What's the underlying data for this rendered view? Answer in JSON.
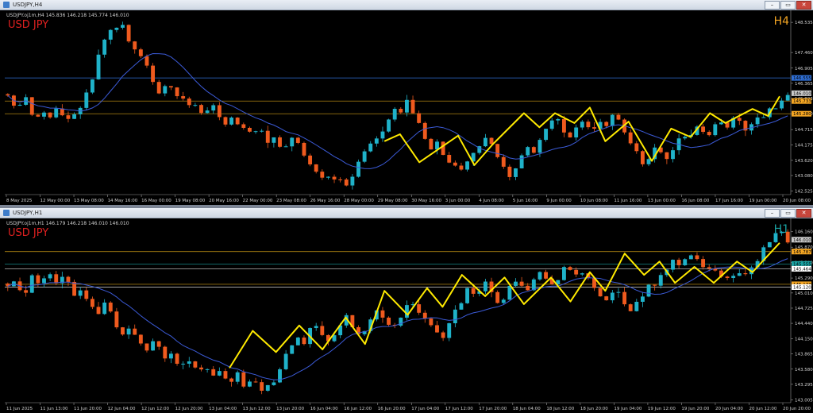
{
  "windows": [
    {
      "id": "h4",
      "title": "USDJPY,H4",
      "info": "USDJPY.oj1m,H4  145.836 146.218 145.774 146.010",
      "symbol_label": "USD JPY",
      "timeframe_label": "H4",
      "timeframe_color": "#f5a623",
      "buttons": {
        "minimize": "–",
        "restore": "▭",
        "close": "✕"
      },
      "chart_data": {
        "type": "candlestick",
        "ylim": [
          142.4,
          148.85
        ],
        "y_ticks": [
          148.535,
          147.46,
          146.905,
          146.365,
          145.823,
          145.28,
          144.715,
          144.175,
          143.62,
          143.08,
          142.525,
          141.985
        ],
        "price_tags": [
          {
            "value": 146.555,
            "color": "#2f6fd6",
            "text": "146.555"
          },
          {
            "value": 146.01,
            "color": "#c9c9c9",
            "text": "146.010"
          },
          {
            "value": 145.733,
            "color": "#f5a623",
            "text": "145.733"
          },
          {
            "value": 145.28,
            "color": "#f5a623",
            "text": "145.280"
          }
        ],
        "h_lines": [
          {
            "value": 146.555,
            "color": "#2f6fd6"
          },
          {
            "value": 145.733,
            "color": "#d4a017"
          },
          {
            "value": 145.28,
            "color": "#d4a017"
          }
        ],
        "x_labels": [
          "8 May 2025",
          "12 May 00:00",
          "13 May 08:00",
          "14 May 16:00",
          "16 May 00:00",
          "19 May 08:00",
          "20 May 16:00",
          "22 May 00:00",
          "23 May 08:00",
          "26 May 16:00",
          "28 May 00:00",
          "29 May 08:00",
          "30 May 16:00",
          "3 Jun 00:00",
          "4 Jun 08:00",
          "5 Jun 16:00",
          "9 Jun 00:00",
          "10 Jun 08:00",
          "11 Jun 16:00",
          "13 Jun 00:00",
          "16 Jun 08:00",
          "17 Jun 16:00",
          "19 Jun 00:00",
          "20 Jun 08:00"
        ],
        "anchors": [
          145.9,
          145.6,
          145.3,
          146.2,
          145.4,
          145.2,
          145.1,
          145.4,
          145.2,
          145.5,
          145.3,
          145.1,
          145.0,
          145.4,
          145.6,
          146.1,
          146.5,
          147.4,
          147.8,
          148.4,
          148.1,
          148.55,
          148.3,
          147.8,
          147.6,
          147.4,
          147.1,
          146.6,
          146.2,
          145.9,
          146.4,
          146.1,
          145.9,
          145.8,
          145.5,
          145.7,
          145.4,
          145.2,
          145.5,
          145.6,
          145.1,
          144.9,
          145.2,
          145.0,
          144.8,
          144.7,
          144.5,
          144.8,
          144.6,
          144.3,
          144.5,
          144.2,
          143.9,
          144.3,
          144.5,
          144.1,
          143.8,
          143.5,
          143.3,
          143.0,
          142.9,
          143.2,
          142.8,
          143.0,
          142.7,
          143.1,
          143.5,
          143.9,
          144.1,
          144.4,
          144.3,
          144.8,
          145.1,
          145.5,
          145.3,
          145.9,
          145.4,
          145.1,
          144.7,
          144.2,
          143.9,
          144.3,
          143.8,
          143.5,
          143.6,
          143.2,
          143.4,
          143.7,
          143.9,
          144.2,
          144.4,
          144.2,
          143.9,
          143.5,
          143.2,
          143.0,
          143.4,
          143.8,
          144.1,
          143.8,
          144.2,
          144.6,
          144.9,
          145.2,
          145.0,
          144.6,
          144.4,
          144.8,
          145.1,
          144.9,
          144.6,
          144.9,
          145.1,
          144.8,
          145.2,
          145.1,
          144.7,
          144.4,
          144.0,
          143.8,
          143.4,
          143.7,
          144.1,
          143.9,
          143.6,
          143.8,
          144.2,
          144.5,
          144.4,
          144.6,
          144.9,
          144.7,
          144.5,
          144.8,
          145.1,
          144.9,
          144.8,
          145.2,
          145.0,
          144.7,
          144.9,
          145.2,
          145.0,
          145.4,
          145.6,
          145.4,
          145.8,
          146.0
        ],
        "ma_color": "#3b5ad6",
        "zigzag_color": "#ffea00",
        "zigzag": [
          [
            0.49,
            144.3
          ],
          [
            0.51,
            144.55
          ],
          [
            0.535,
            143.55
          ],
          [
            0.585,
            144.5
          ],
          [
            0.606,
            143.45
          ],
          [
            0.63,
            144.2
          ],
          [
            0.67,
            145.3
          ],
          [
            0.69,
            144.8
          ],
          [
            0.71,
            145.3
          ],
          [
            0.735,
            144.95
          ],
          [
            0.755,
            145.5
          ],
          [
            0.775,
            144.3
          ],
          [
            0.805,
            145.0
          ],
          [
            0.835,
            143.6
          ],
          [
            0.86,
            144.75
          ],
          [
            0.885,
            144.45
          ],
          [
            0.91,
            145.3
          ],
          [
            0.93,
            144.95
          ],
          [
            0.965,
            145.45
          ],
          [
            0.985,
            145.2
          ],
          [
            1.0,
            145.9
          ]
        ]
      }
    },
    {
      "id": "h1",
      "title": "USDJPY,H1",
      "info": "USDJPY.oj1m,H1  146.179 146.218 146.010 146.010",
      "symbol_label": "USD JPY",
      "timeframe_label": "H1",
      "timeframe_color": "#1aa3a3",
      "buttons": {
        "minimize": "–",
        "restore": "▭",
        "close": "✕"
      },
      "chart_data": {
        "type": "candlestick",
        "ylim": [
          142.95,
          146.35
        ],
        "y_ticks": [
          146.16,
          145.87,
          145.58,
          145.29,
          145.01,
          144.725,
          144.44,
          144.15,
          143.865,
          143.58,
          143.295,
          143.005,
          142.72
        ],
        "price_tags": [
          {
            "value": 146.01,
            "color": "#c9c9c9",
            "text": "146.010"
          },
          {
            "value": 145.787,
            "color": "#f5a623",
            "text": "145.787"
          },
          {
            "value": 145.555,
            "color": "#1aa3a3",
            "text": "145.555"
          },
          {
            "value": 145.464,
            "color": "#ffffff",
            "text": "145.464"
          },
          {
            "value": 145.173,
            "color": "#f5a623",
            "text": "145.173"
          },
          {
            "value": 145.12,
            "color": "#ffffff",
            "text": "145.120"
          }
        ],
        "h_lines": [
          {
            "value": 145.787,
            "color": "#d4a017"
          },
          {
            "value": 145.555,
            "color": "#1aa3a3"
          },
          {
            "value": 145.464,
            "color": "#d8d8d8"
          },
          {
            "value": 145.173,
            "color": "#d4a017"
          },
          {
            "value": 145.12,
            "color": "#d8d8d8"
          }
        ],
        "x_labels": [
          "11 Jun 2025",
          "11 Jun 13:00",
          "11 Jun 20:00",
          "12 Jun 04:00",
          "12 Jun 12:00",
          "12 Jun 20:00",
          "13 Jun 04:00",
          "13 Jun 12:00",
          "13 Jun 20:00",
          "16 Jun 04:00",
          "16 Jun 12:00",
          "16 Jun 20:00",
          "17 Jun 04:00",
          "17 Jun 12:00",
          "17 Jun 20:00",
          "18 Jun 04:00",
          "18 Jun 12:00",
          "18 Jun 20:00",
          "19 Jun 04:00",
          "19 Jun 12:00",
          "19 Jun 20:00",
          "20 Jun 04:00",
          "20 Jun 12:00",
          "20 Jun 20:00"
        ],
        "anchors": [
          145.1,
          145.2,
          145.0,
          145.3,
          145.1,
          145.4,
          145.2,
          145.3,
          145.0,
          145.1,
          144.8,
          144.6,
          144.9,
          144.5,
          144.2,
          144.4,
          144.1,
          143.9,
          144.2,
          143.8,
          143.9,
          143.6,
          143.8,
          143.5,
          143.7,
          143.4,
          143.6,
          143.3,
          143.5,
          143.2,
          143.4,
          143.1,
          143.3,
          143.5,
          143.9,
          144.2,
          144.0,
          144.4,
          144.3,
          144.1,
          144.3,
          144.6,
          144.4,
          144.2,
          144.5,
          144.7,
          144.4,
          144.3,
          144.6,
          144.9,
          144.7,
          144.5,
          144.3,
          144.2,
          144.5,
          144.8,
          145.1,
          144.9,
          145.2,
          145.0,
          144.8,
          145.1,
          145.3,
          145.0,
          145.2,
          145.4,
          145.2,
          145.3,
          145.5,
          145.3,
          145.4,
          145.2,
          145.0,
          144.9,
          145.1,
          144.8,
          144.7,
          144.9,
          145.1,
          145.2,
          145.4,
          145.6,
          145.5,
          145.7,
          145.6,
          145.4,
          145.5,
          145.3,
          145.2,
          145.4,
          145.3,
          145.6,
          145.8,
          146.0,
          146.2,
          146.0
        ],
        "ma_color": "#3b5ad6",
        "zigzag_color": "#ffea00",
        "zigzag": [
          [
            0.29,
            143.6
          ],
          [
            0.32,
            144.3
          ],
          [
            0.35,
            143.9
          ],
          [
            0.38,
            144.4
          ],
          [
            0.41,
            143.95
          ],
          [
            0.44,
            144.55
          ],
          [
            0.465,
            144.05
          ],
          [
            0.49,
            145.05
          ],
          [
            0.52,
            144.6
          ],
          [
            0.545,
            145.1
          ],
          [
            0.565,
            144.75
          ],
          [
            0.59,
            145.35
          ],
          [
            0.62,
            144.95
          ],
          [
            0.645,
            145.3
          ],
          [
            0.67,
            144.8
          ],
          [
            0.705,
            145.3
          ],
          [
            0.73,
            144.85
          ],
          [
            0.755,
            145.4
          ],
          [
            0.775,
            145.05
          ],
          [
            0.8,
            145.75
          ],
          [
            0.825,
            145.35
          ],
          [
            0.845,
            145.6
          ],
          [
            0.865,
            145.2
          ],
          [
            0.89,
            145.5
          ],
          [
            0.915,
            145.2
          ],
          [
            0.945,
            145.6
          ],
          [
            0.965,
            145.4
          ],
          [
            1.0,
            145.95
          ]
        ]
      }
    }
  ]
}
